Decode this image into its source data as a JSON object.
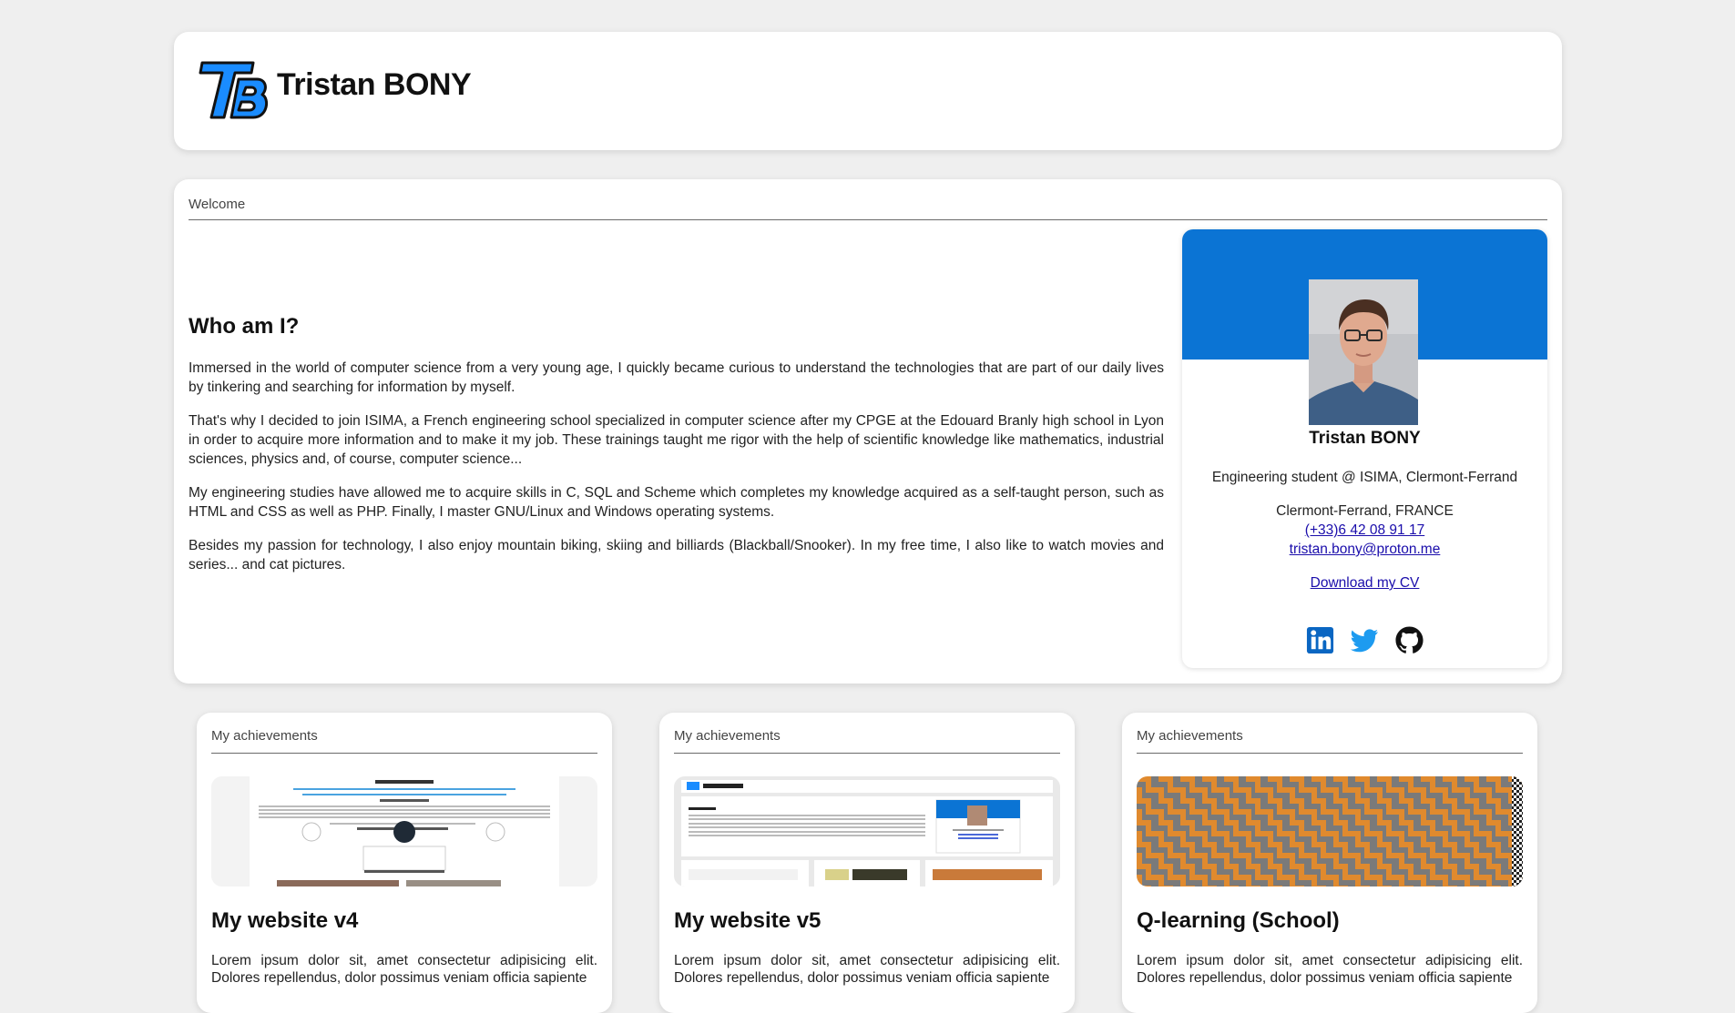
{
  "header": {
    "site_title": "Tristan BONY",
    "logo_icon": "tb-logo-icon",
    "accent": "#1a8cff"
  },
  "welcome": {
    "section_label": "Welcome",
    "heading": "Who am I?",
    "paragraphs": [
      "Immersed in the world of computer science from a very young age, I quickly became curious to understand the technologies that are part of our daily lives by tinkering and searching for information by myself.",
      "That's why I decided to join ISIMA, a French engineering school specialized in computer science after my CPGE at the Edouard Branly high school in Lyon in order to acquire more information and to make it my job. These trainings taught me rigor with the help of scientific knowledge like mathematics, industrial sciences, physics and, of course, computer science...",
      "My engineering studies have allowed me to acquire skills in C, SQL and Scheme which completes my knowledge acquired as a self-taught person, such as HTML and CSS as well as PHP. Finally, I master GNU/Linux and Windows operating systems.",
      "Besides my passion for technology, I also enjoy mountain biking, skiing and billiards (Blackball/Snooker). In my free time, I also like to watch movies and series... and cat pictures."
    ]
  },
  "profile": {
    "banner_color": "#0b74d4",
    "name": "Tristan BONY",
    "role": "Engineering student @ ISIMA, Clermont-Ferrand",
    "location": "Clermont-Ferrand, FRANCE",
    "phone": "(+33)6 42 08 91 17",
    "email": "tristan.bony@proton.me",
    "cv_link": "Download my CV",
    "socials": [
      "linkedin-icon",
      "twitter-icon",
      "github-icon"
    ]
  },
  "achievements": [
    {
      "section_label": "My achievements",
      "title": "My website v4",
      "description": "Lorem ipsum dolor sit, amet consectetur adipisicing elit. Dolores repellendus, dolor possimus veniam officia sapiente"
    },
    {
      "section_label": "My achievements",
      "title": "My website v5",
      "description": "Lorem ipsum dolor sit, amet consectetur adipisicing elit. Dolores repellendus, dolor possimus veniam officia sapiente"
    },
    {
      "section_label": "My achievements",
      "title": "Q-learning (School)",
      "description": "Lorem ipsum dolor sit, amet consectetur adipisicing elit. Dolores repellendus, dolor possimus veniam officia sapiente"
    }
  ]
}
